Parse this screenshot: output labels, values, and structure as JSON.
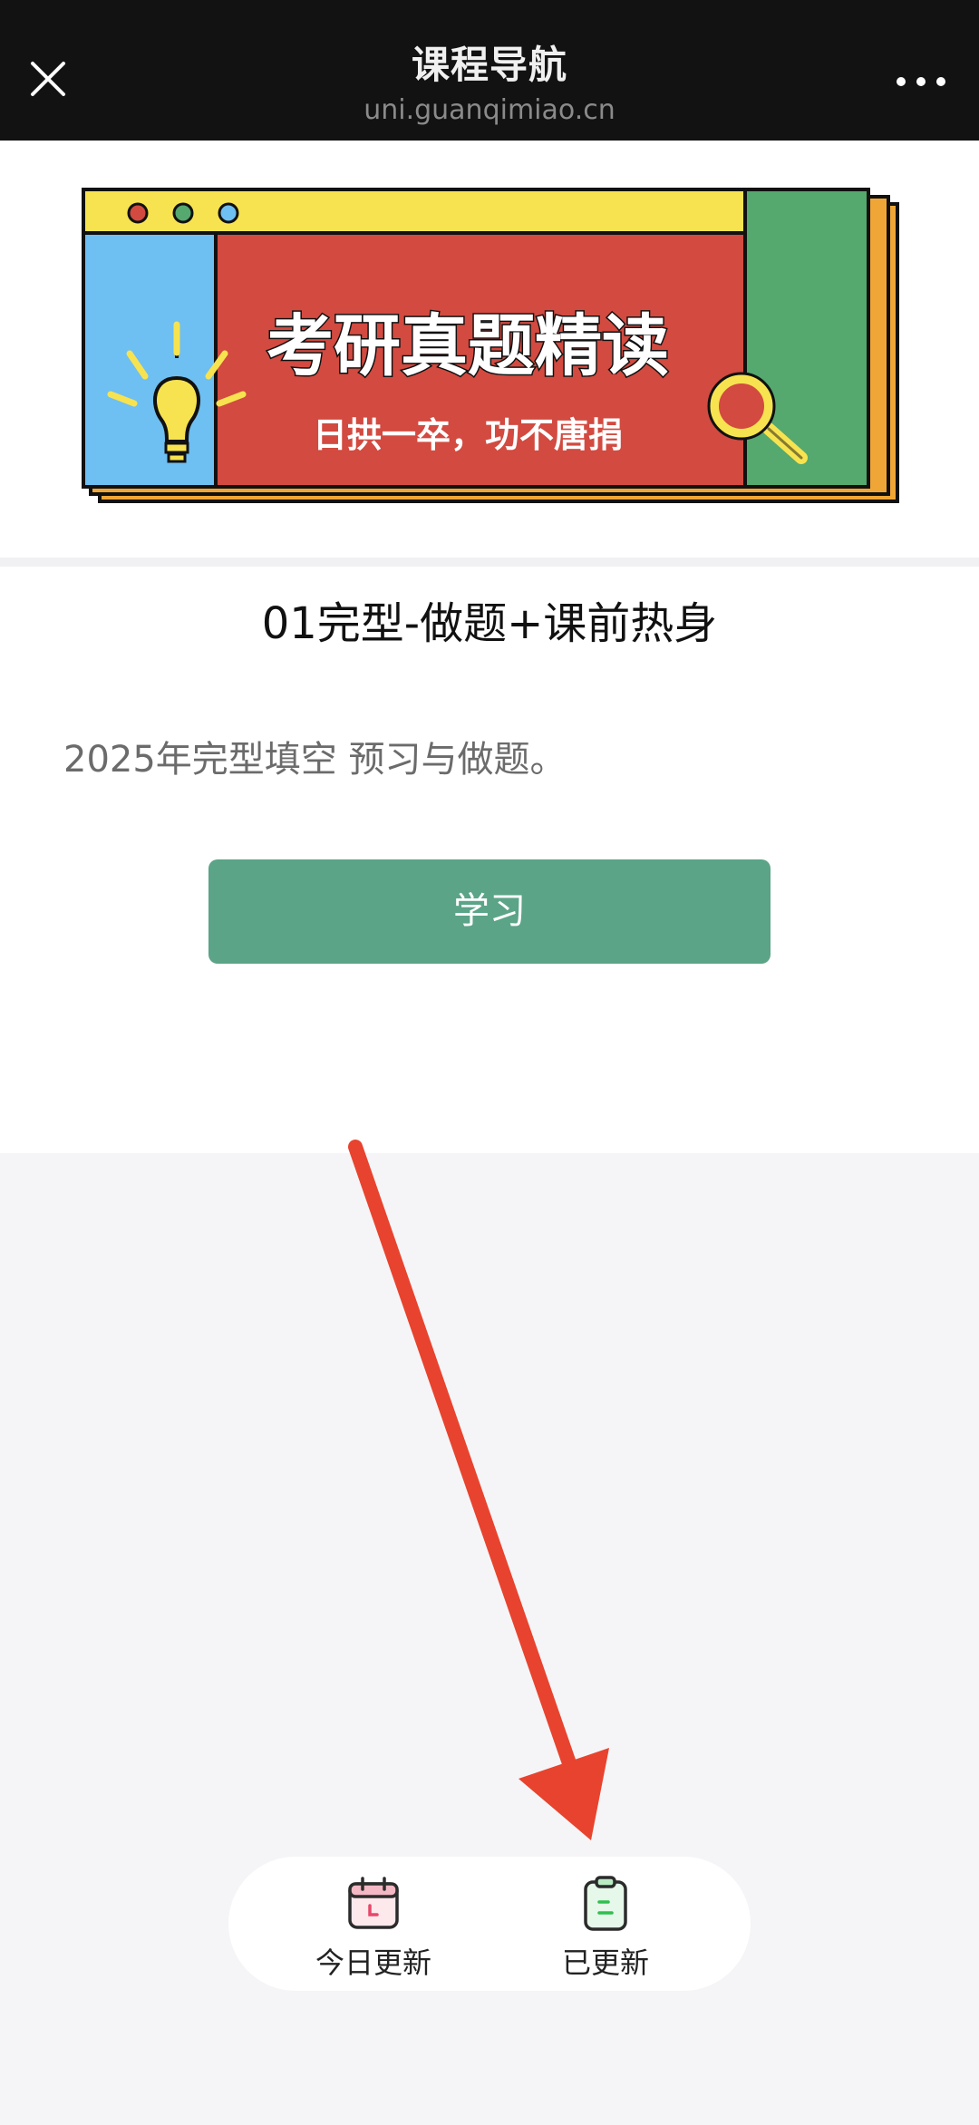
{
  "topbar": {
    "title": "课程导航",
    "url": "uni.guanqimiao.cn",
    "close_icon": "close-icon",
    "more_icon": "more-dots-icon"
  },
  "banner": {
    "headline": "考研真题精读",
    "tagline": "日拱一卒，功不唐捐",
    "colors": {
      "yellow": "#f7e34f",
      "blue": "#6ebff2",
      "red": "#d24a40",
      "green": "#55a86e",
      "orange": "#f0a636",
      "outline": "#111111"
    }
  },
  "course": {
    "title": "01完型-做题+课前热身",
    "description": "2025年完型填空 预习与做题。",
    "button_label": "学习",
    "button_color": "#5ba487"
  },
  "annotation": {
    "arrow_color": "#e8432e"
  },
  "bottom_nav": {
    "items": [
      {
        "label": "今日更新",
        "icon": "calendar-icon"
      },
      {
        "label": "已更新",
        "icon": "clipboard-icon"
      }
    ]
  }
}
